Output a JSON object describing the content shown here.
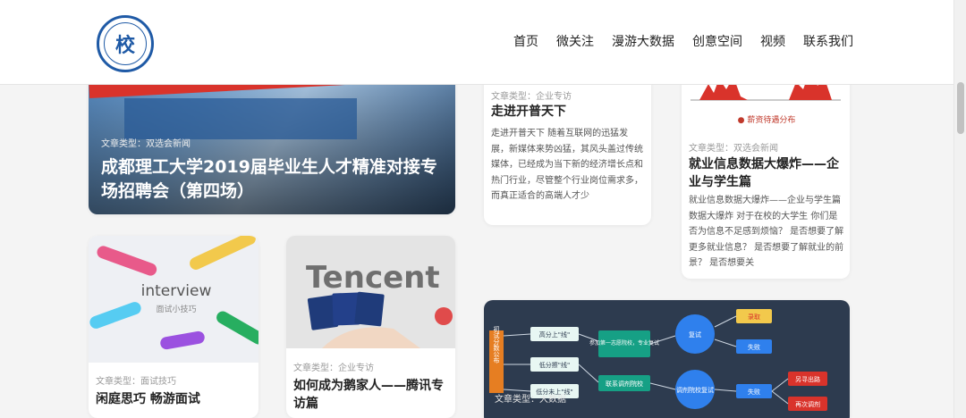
{
  "header": {
    "logo_text": "校",
    "nav": [
      "首页",
      "微关注",
      "漫游大数据",
      "创意空间",
      "视频",
      "联系我们"
    ]
  },
  "cards": {
    "hero": {
      "meta": "文章类型：双选会新闻",
      "title": "成都理工大学2019届毕业生人才精准对接专场招聘会（第四场）"
    },
    "kaipu": {
      "meta": "文章类型：企业专访",
      "title": "走进开普天下",
      "excerpt": "走进开普天下 随着互联网的迅猛发展，新媒体来势凶猛，其风头盖过传统媒体，已经成为当下新的经济增长点和热门行业，尽管整个行业岗位需求多，而真正适合的高端人才少"
    },
    "jiuye": {
      "chart_caption": "● 薪资待遇分布",
      "meta": "文章类型：双选会新闻",
      "title": "就业信息数据大爆炸——企业与学生篇",
      "excerpt": "就业信息数据大爆炸——企业与学生篇数据大爆炸 对于在校的大学生 你们是否为信息不足感到烦恼？ 是否想要了解更多就业信息？ 是否想要了解就业的前景？ 是否想要关"
    },
    "interview": {
      "img_title": "interview",
      "img_subtitle": "面试小技巧",
      "meta": "文章类型：面试技巧",
      "title": "闲庭思巧 畅游面试"
    },
    "tencent": {
      "img_brand": "Tencent",
      "meta": "文章类型：企业专访",
      "title": "如何成为鹅家人——腾讯专访篇"
    },
    "flow": {
      "meta": "文章类型：大数据",
      "nodes": {
        "left": "初试分数公布",
        "high": "高分上\"线\"",
        "low": "低分擦\"线\"",
        "none": "低分未上\"线\"",
        "first": "参加第一志愿院校，专业复试",
        "adjust": "联系调剂院校",
        "retest": "复试",
        "admit": "录取",
        "fail": "失败",
        "fail2": "失败",
        "re_admit": "调剂院校复试",
        "other": "另寻出路",
        "redo": "再次调剂"
      }
    }
  },
  "colors": {
    "brand": "#1f5aa6",
    "hero_banner": "#d9332b",
    "flow_bg": "#2d3b4f"
  }
}
